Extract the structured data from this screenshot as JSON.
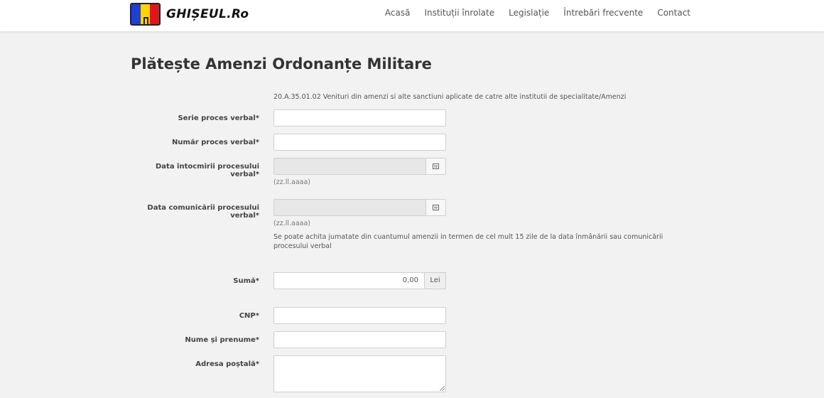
{
  "header": {
    "logo_text": "GHIȘEUL.Ro",
    "nav": [
      "Acasă",
      "Instituții înrolate",
      "Legislație",
      "Întrebări frecvente",
      "Contact"
    ]
  },
  "page": {
    "title": "Plătește Amenzi Ordonanțe Militare",
    "account_description": "20.A.35.01.02 Venituri din amenzi si alte sanctiuni aplicate de catre alte institutii de specialitate/Amenzi"
  },
  "form": {
    "serie_label": "Serie proces verbal*",
    "serie_value": "",
    "numar_label": "Număr proces verbal*",
    "numar_value": "",
    "data_intocmire_label": "Data întocmirii procesului verbal*",
    "data_intocmire_hint": "(zz.ll.aaaa)",
    "data_comunicare_label": "Data comunicării procesului verbal*",
    "data_comunicare_hint": "(zz.ll.aaaa)",
    "note": "Se poate achita jumatate din cuantumul amenzii in termen de cel mult 15 zile de la data înmânării sau comunicării procesului verbal",
    "suma_label": "Sumă*",
    "suma_value": "0,00",
    "suma_unit": "Lei",
    "cnp_label": "CNP*",
    "cnp_value": "",
    "nume_label": "Nume și prenume*",
    "nume_value": "",
    "adresa_label": "Adresa poștală*",
    "adresa_value": ""
  },
  "colors": {
    "background": "#f2f2f2",
    "flag_blue": "#1f3fd6",
    "flag_yellow": "#ffd500",
    "flag_red": "#e0161b"
  }
}
